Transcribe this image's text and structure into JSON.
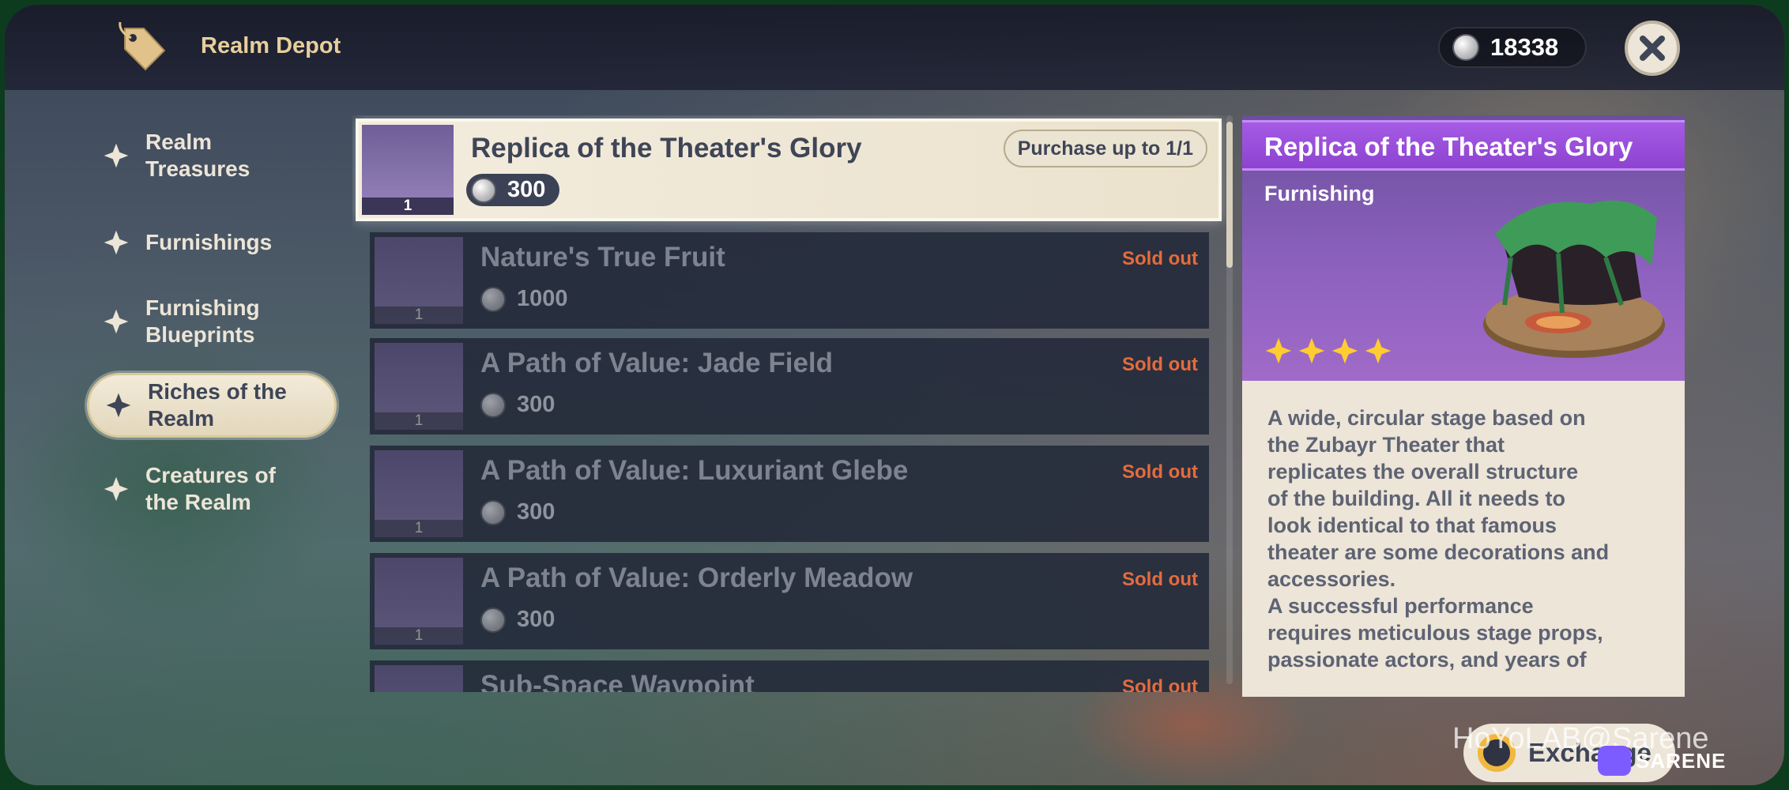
{
  "header": {
    "title": "Realm Depot",
    "currency_value": "18338"
  },
  "sidebar": {
    "items": [
      {
        "label": "Realm\nTreasures"
      },
      {
        "label": "Furnishings"
      },
      {
        "label": "Furnishing\nBlueprints"
      },
      {
        "label": "Riches of the\nRealm"
      },
      {
        "label": "Creatures of\nthe Realm"
      }
    ],
    "active_index": 3
  },
  "list": {
    "items": [
      {
        "name": "Replica of the Theater's Glory",
        "price": "300",
        "quantity": "1",
        "status": "Purchase up to 1/1",
        "selected": true
      },
      {
        "name": "Nature's True Fruit",
        "price": "1000",
        "quantity": "1",
        "status": "Sold out"
      },
      {
        "name": "A Path of Value: Jade Field",
        "price": "300",
        "quantity": "1",
        "status": "Sold out"
      },
      {
        "name": "A Path of Value: Luxuriant Glebe",
        "price": "300",
        "quantity": "1",
        "status": "Sold out"
      },
      {
        "name": "A Path of Value: Orderly Meadow",
        "price": "300",
        "quantity": "1",
        "status": "Sold out"
      },
      {
        "name": "Sub-Space Waypoint",
        "price": "",
        "quantity": "",
        "status": "Sold out"
      }
    ]
  },
  "detail": {
    "title": "Replica of the Theater's Glory",
    "type": "Furnishing",
    "rarity": 4,
    "description": "A wide, circular stage based on\nthe Zubayr Theater that\nreplicates the overall structure\nof the building. All it needs to\nlook identical to that famous\ntheater are some decorations and\naccessories.\nA successful performance\nrequires meticulous stage props,\npassionate actors, and years of"
  },
  "footer": {
    "exchange_label": "Exchange",
    "watermark": "HoYoLAB@Sarene",
    "watermark_logo_text": "SARENE"
  },
  "colors": {
    "accent_gold": "#e7cf9c",
    "sold_out": "#e56b3d",
    "rarity_purple": "#8d43cf",
    "star": "#ffcc32"
  }
}
